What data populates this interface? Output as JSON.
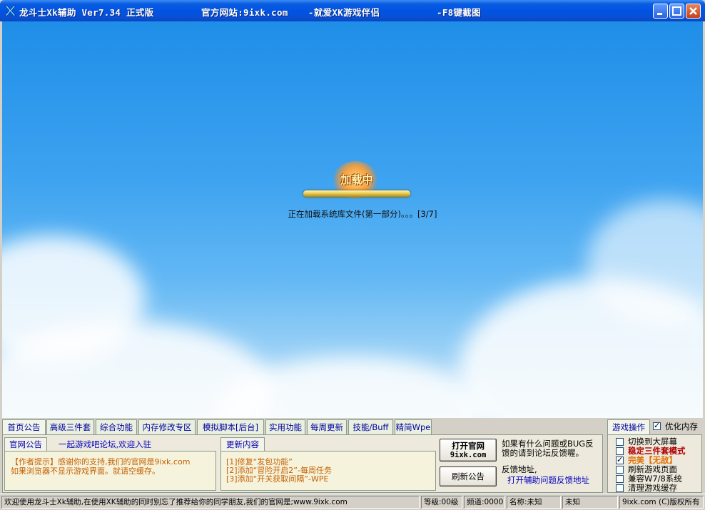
{
  "window": {
    "app_title": "龙斗士Xk辅助 Ver7.34 正式版",
    "site_text": "官方网站:9ixk.com",
    "slogan": "-就爱XK游戏伴侣",
    "hotkey_hint": "-F8键截图"
  },
  "loader": {
    "badge": "加载中",
    "message": "正在加载系统库文件(第一部分)。。。[3/7]"
  },
  "tabs": [
    "首页公告",
    "高级三件套",
    "综合功能",
    "内存修改专区",
    "模拟脚本[后台]",
    "实用功能",
    "每周更新",
    "技能/Buff",
    "精简Wpe"
  ],
  "home": {
    "subtab_notice": "官网公告",
    "forum_text": "一起游戏吧论坛,欢迎入驻",
    "notice_line1": "【作者提示】感谢你的支持,我们的官网是9ixk.com",
    "notice_line2": "如果浏览器不显示游戏界面。就请空缓存。",
    "subtab_updates": "更新内容",
    "updates": [
      "[1]修复“发包功能”",
      "[2]添加“冒险开启2”-每周任务",
      "[3]添加“开关获取间隔”-WPE"
    ],
    "open_site_line1": "打开官网",
    "open_site_line2": "9ixk.com",
    "refresh_button": "刷新公告",
    "feedback_line1": "如果有什么问题或BUG反",
    "feedback_line2": "馈的请到论坛反馈喔。",
    "feedback_addr_label": "反馈地址,",
    "feedback_link": "打开辅助问题反馈地址"
  },
  "game_ops": {
    "tab": "游戏操作",
    "optimize_memory": "优化内存",
    "options": [
      {
        "label": "切换到大屏幕",
        "checked": false,
        "color": "#000000"
      },
      {
        "label": "稳定三件套模式",
        "checked": false,
        "color": "#b00000"
      },
      {
        "label": "完美【无敌】",
        "checked": true,
        "color": "#e07000"
      },
      {
        "label": "刷新游戏页面",
        "checked": false,
        "color": "#000000"
      },
      {
        "label": "兼容W7/8系统",
        "checked": false,
        "color": "#000000"
      },
      {
        "label": "清理游戏缓存",
        "checked": false,
        "color": "#000000"
      }
    ]
  },
  "statusbar": {
    "welcome": "欢迎使用龙斗士Xk辅助,在使用XK辅助的同时别忘了推荐给你的同学朋友,我们的官网是;www.9ixk.com",
    "level": "等级:00级",
    "channel": "频道:0000",
    "name": "名称:未知",
    "unknown": "未知",
    "copyright": "9ixk.com (C)版权所有"
  }
}
